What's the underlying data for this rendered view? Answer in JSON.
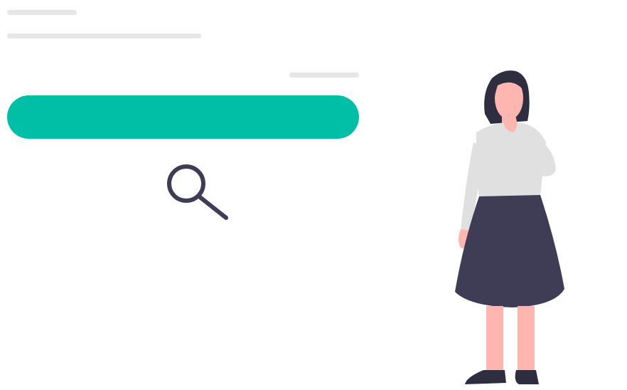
{
  "colors": {
    "accent": "#00bfa6",
    "placeholder_line": "#e6e6e6",
    "icon_stroke": "#3f3d56",
    "skin": "#ffb6b0",
    "hair": "#2f2e41",
    "sweater": "#e0e0e0",
    "skirt": "#3f3d56",
    "shoes": "#2f2e41"
  },
  "search": {
    "icon": "search-icon"
  },
  "illustration": {
    "figure": "woman-thinking"
  }
}
